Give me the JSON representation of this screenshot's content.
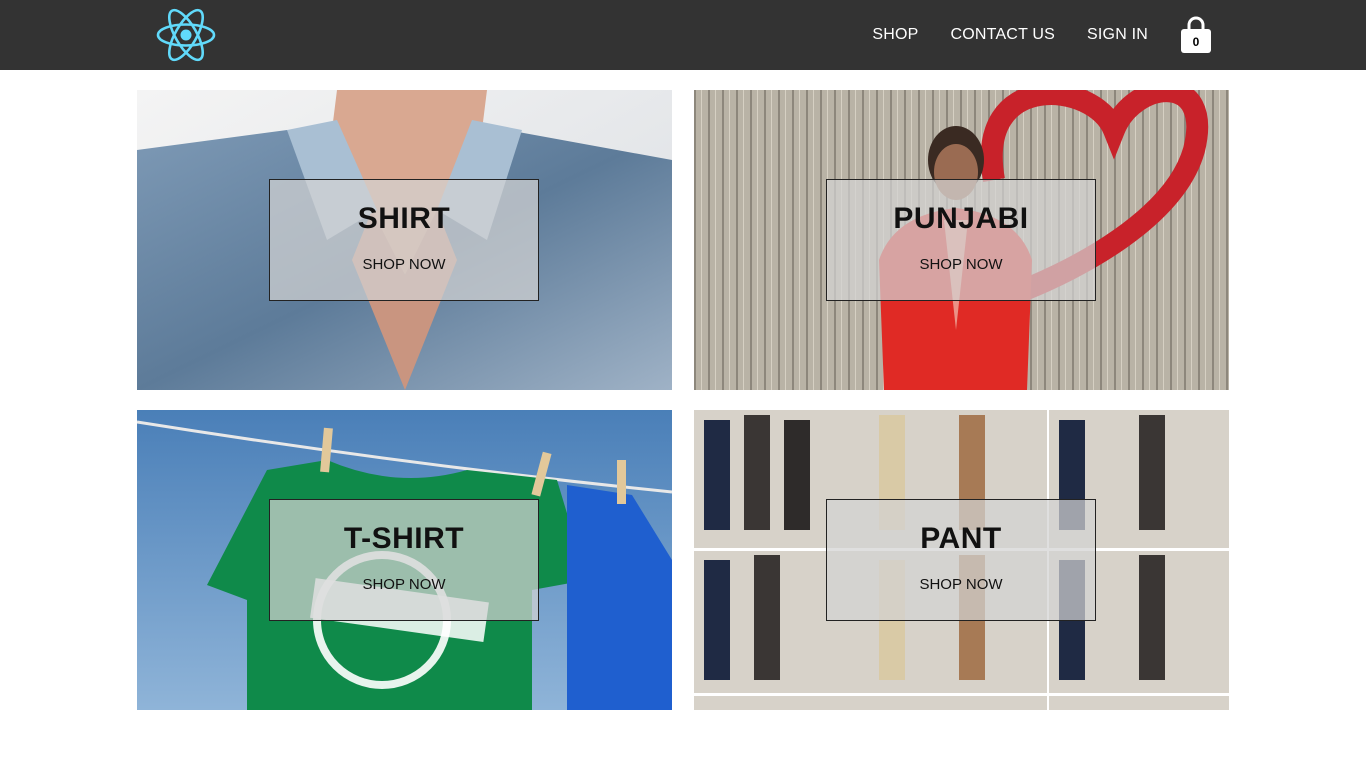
{
  "navbar": {
    "logo_icon": "react-atom-icon",
    "links": [
      "SHOP",
      "CONTACT US",
      "SIGN IN"
    ],
    "cart": {
      "icon": "shopping-bag-icon",
      "count": "0"
    }
  },
  "categories": [
    {
      "title": "SHIRT",
      "action": "SHOP NOW"
    },
    {
      "title": "PUNJABI",
      "action": "SHOP NOW"
    },
    {
      "title": "T-SHIRT",
      "action": "SHOP NOW"
    },
    {
      "title": "PANT",
      "action": "SHOP NOW"
    }
  ],
  "colors": {
    "navbar_bg": "#333333",
    "logo": "#61dafb",
    "nav_text": "#ffffff"
  }
}
